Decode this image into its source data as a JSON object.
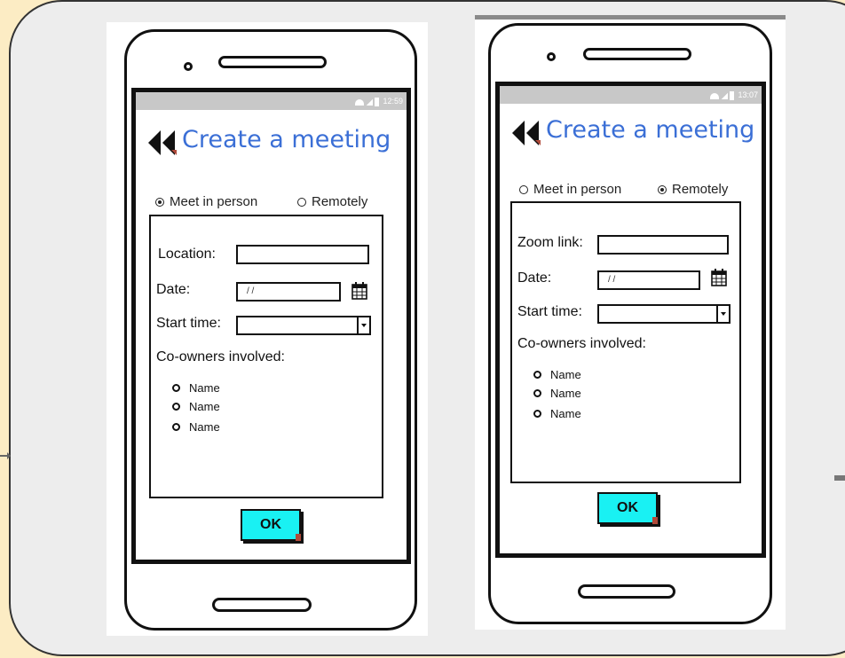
{
  "screens": [
    {
      "status_time": "12:59",
      "title": "Create a meeting",
      "mode_options": [
        {
          "label": "Meet in person",
          "selected": true
        },
        {
          "label": "Remotely",
          "selected": false
        }
      ],
      "field1_label": "Location:",
      "date_label": "Date:",
      "date_value": "/ /",
      "start_time_label": "Start time:",
      "coowners_label": "Co-owners involved:",
      "coowners": [
        "Name",
        "Name",
        "Name"
      ],
      "ok_label": "OK"
    },
    {
      "status_time": "13:07",
      "title": "Create a meeting",
      "mode_options": [
        {
          "label": "Meet in person",
          "selected": false
        },
        {
          "label": "Remotely",
          "selected": true
        }
      ],
      "field1_label": "Zoom link:",
      "date_label": "Date:",
      "date_value": "/ /",
      "start_time_label": "Start time:",
      "coowners_label": "Co-owners involved:",
      "coowners": [
        "Name",
        "Name",
        "Name"
      ],
      "ok_label": "OK"
    }
  ],
  "colors": {
    "accent_title": "#3b6fd6",
    "ok_button": "#19f1f3",
    "board": "#ededed",
    "background": "#fcecc4"
  }
}
